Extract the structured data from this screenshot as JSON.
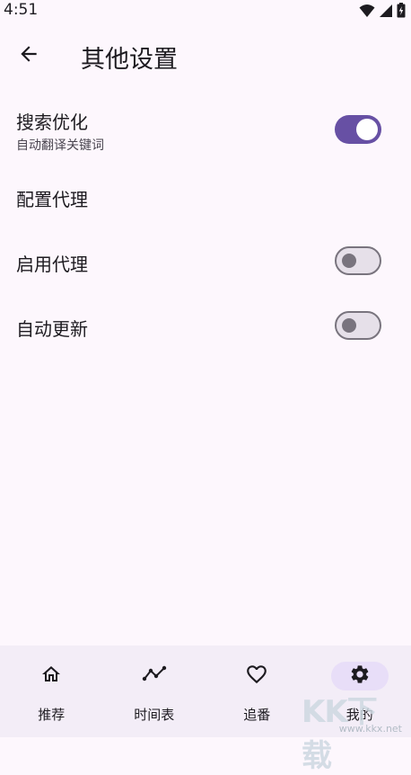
{
  "status_bar": {
    "time": "4:51",
    "icons": [
      "wifi-icon",
      "signal-icon",
      "battery-icon"
    ]
  },
  "app_bar": {
    "back_icon": "arrow-back-icon",
    "title": "其他设置"
  },
  "settings": [
    {
      "title": "搜索优化",
      "subtitle": "自动翻译关键词",
      "control": "switch",
      "checked": true
    },
    {
      "title": "配置代理",
      "control": "none"
    },
    {
      "title": "启用代理",
      "control": "switch",
      "checked": false
    },
    {
      "title": "自动更新",
      "control": "switch",
      "checked": false
    }
  ],
  "bottom_nav": [
    {
      "label": "推荐",
      "icon": "home-icon",
      "active": false
    },
    {
      "label": "时间表",
      "icon": "timeline-icon",
      "active": false
    },
    {
      "label": "追番",
      "icon": "heart-icon",
      "active": false
    },
    {
      "label": "我的",
      "icon": "gear-icon",
      "active": true
    }
  ],
  "watermark": {
    "logo": "KK下载",
    "url": "www.kkx.net"
  },
  "colors": {
    "background": "#fdf7fd",
    "accent": "#6750a4",
    "nav_background": "#f3edf7",
    "nav_indicator": "#e8def8"
  }
}
